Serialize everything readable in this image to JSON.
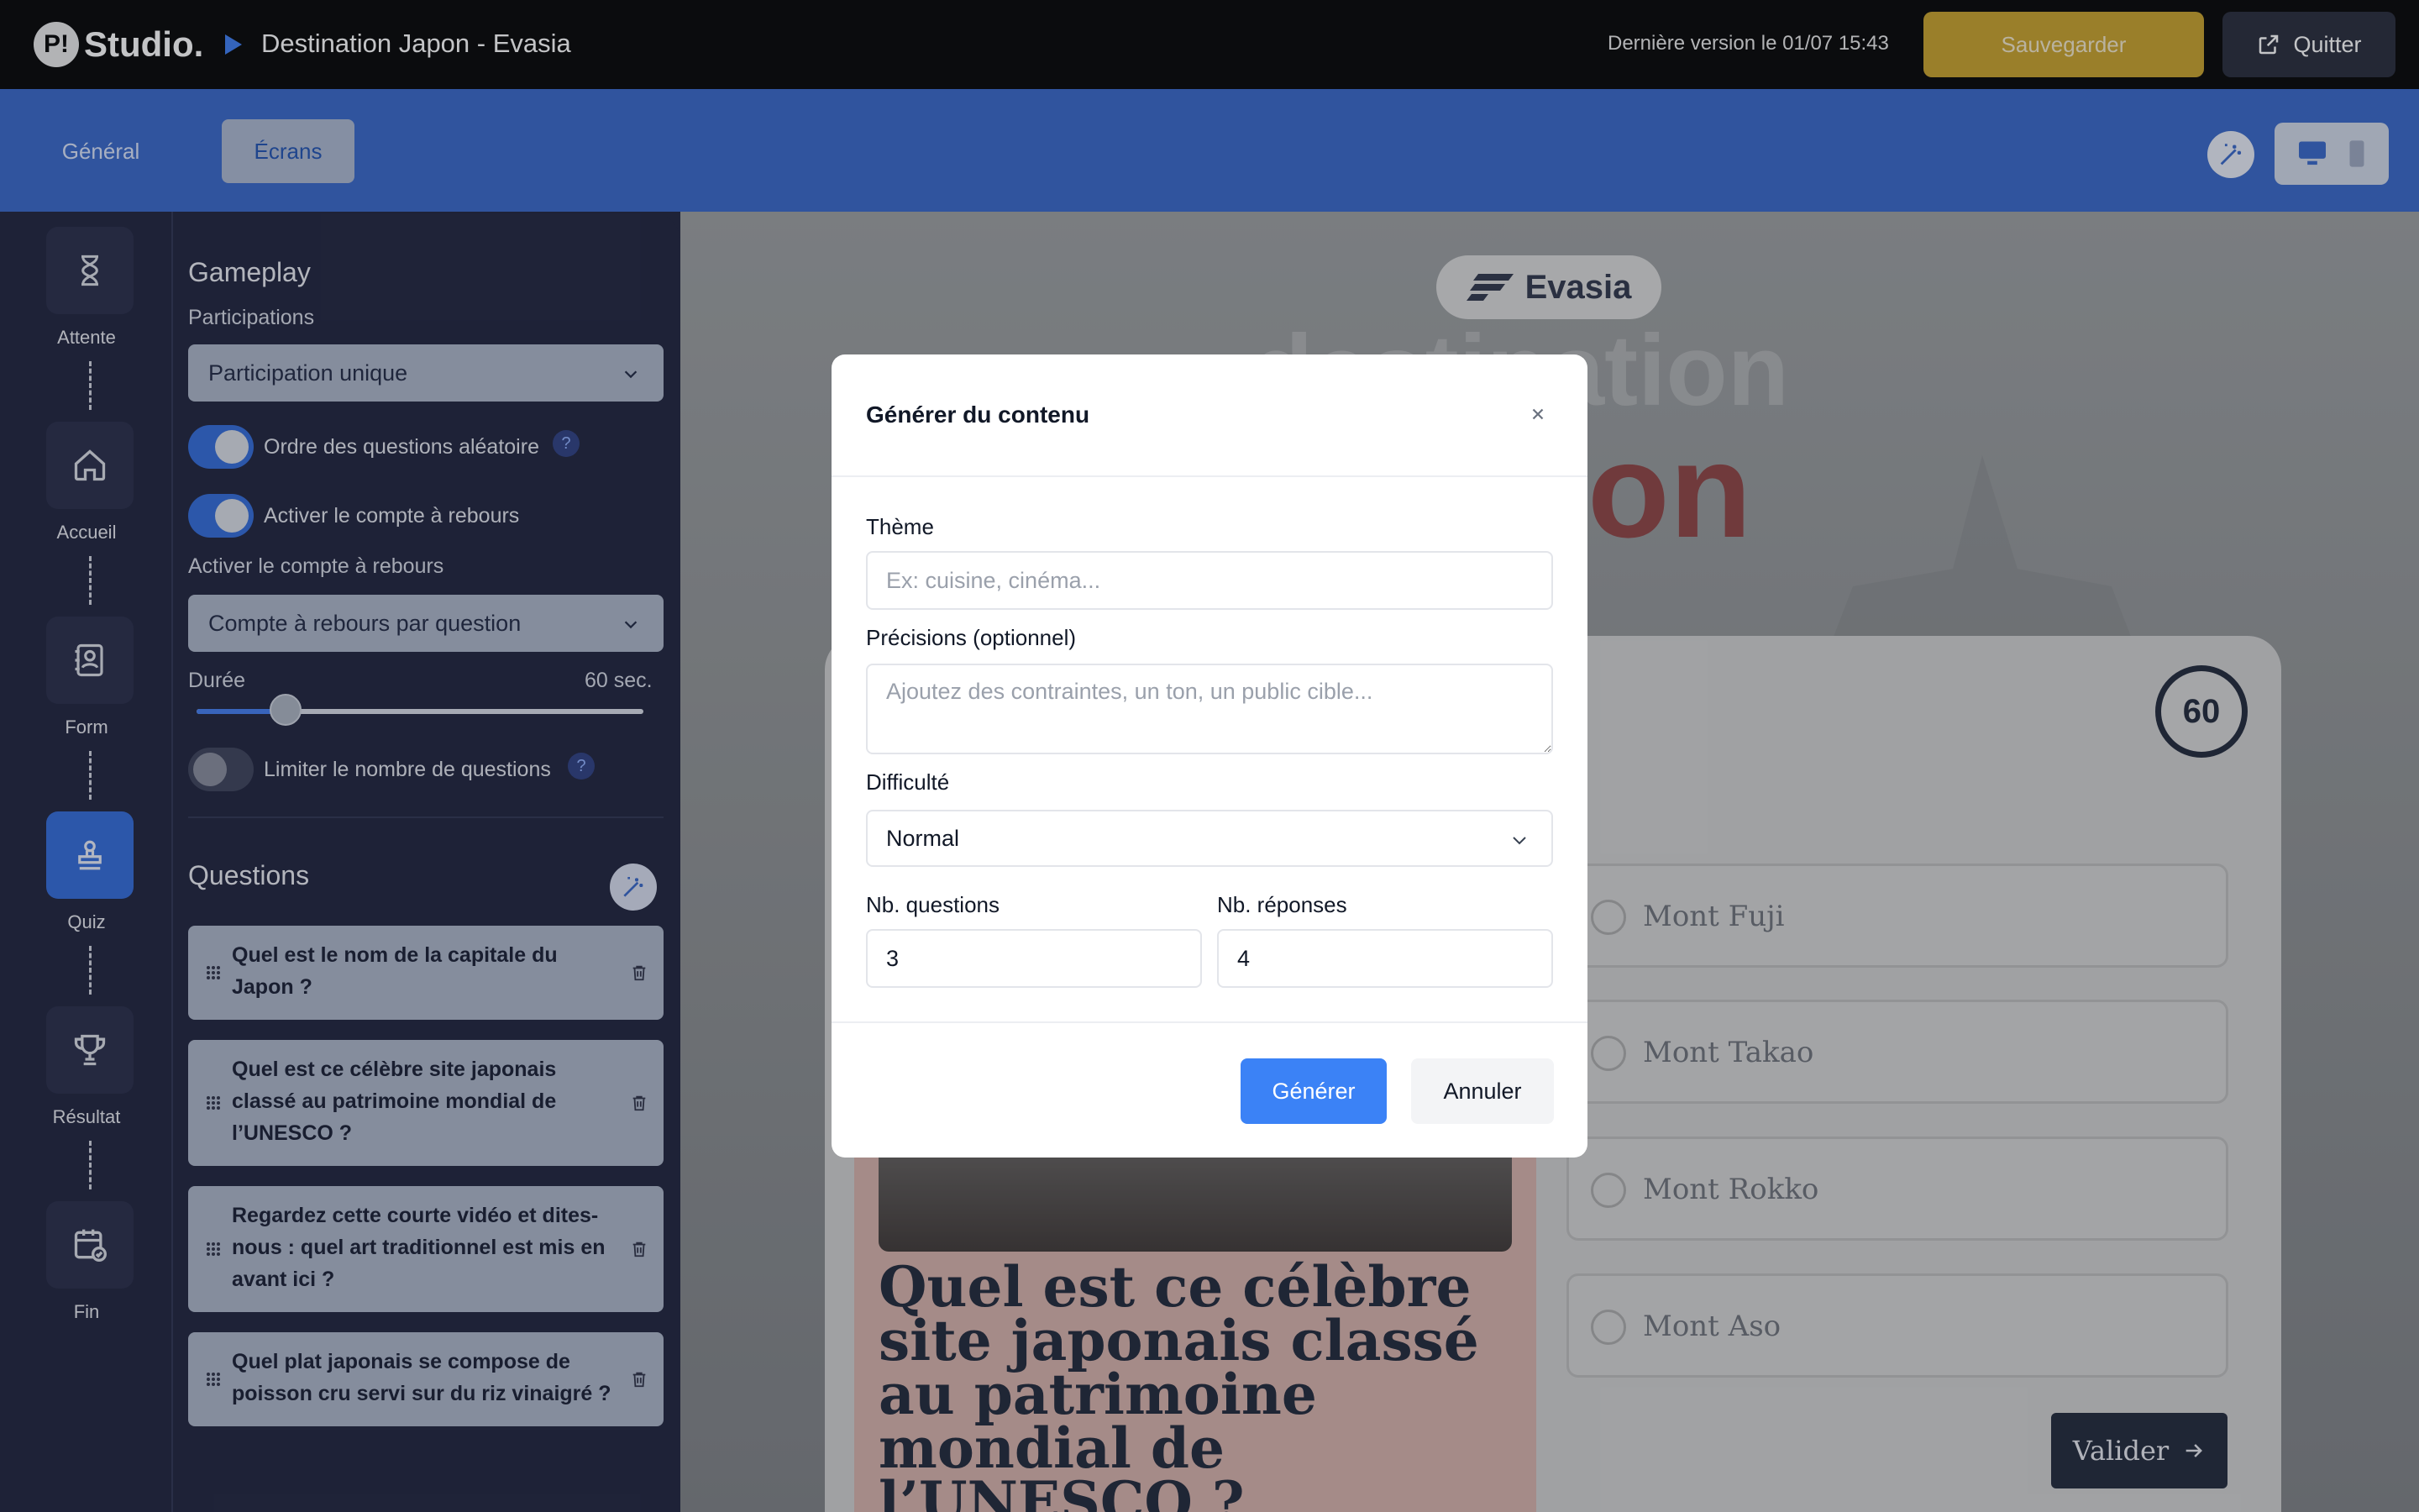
{
  "app": {
    "logo_badge": "P!",
    "logo_text": "Studio.",
    "project_title": "Destination Japon - Evasia",
    "last_version": "Dernière version le 01/07 15:43",
    "save_label": "Sauvegarder",
    "quit_label": "Quitter"
  },
  "tabs": [
    {
      "label": "Général",
      "active": false
    },
    {
      "label": "Écrans",
      "active": true
    }
  ],
  "rail": [
    {
      "label": "Attente",
      "icon": "hourglass-icon",
      "active": false
    },
    {
      "label": "Accueil",
      "icon": "home-icon",
      "active": false
    },
    {
      "label": "Form",
      "icon": "contact-form-icon",
      "active": false
    },
    {
      "label": "Quiz",
      "icon": "quiz-stamp-icon",
      "active": true
    },
    {
      "label": "Résultat",
      "icon": "trophy-icon",
      "active": false
    },
    {
      "label": "Fin",
      "icon": "calendar-check-icon",
      "active": false
    }
  ],
  "settings": {
    "gameplay_title": "Gameplay",
    "participations_label": "Participations",
    "participations_value": "Participation unique",
    "random_order_label": "Ordre des questions aléatoire",
    "random_order_on": true,
    "countdown_toggle_label": "Activer le compte à rebours",
    "countdown_on": true,
    "countdown_select_label": "Activer le compte à rebours",
    "countdown_select_value": "Compte à rebours par question",
    "duration_label": "Durée",
    "duration_value": "60 sec.",
    "duration_slider_fraction": 0.2,
    "limit_label": "Limiter le nombre de questions",
    "limit_on": false,
    "help_glyph": "?"
  },
  "questions": {
    "title": "Questions",
    "items": [
      "Quel est le nom de la capitale du Japon ?",
      "Quel est ce célèbre site japonais classé au patrimoine mondial de l’UNESCO ?",
      "Regardez cette courte vidéo et dites-nous : quel art traditionnel est mis en avant ici ?",
      "Quel plat japonais se compose de poisson cru servi sur du riz vinaigré ?"
    ]
  },
  "preview": {
    "brand": "Evasia",
    "timer": "60",
    "question": "Quel est ce célèbre site japonais classé au patrimoine mondial de l’UNESCO ?",
    "answers": [
      "Mont Fuji",
      "Mont Takao",
      "Mont Rokko",
      "Mont Aso"
    ],
    "validate_label": "Valider"
  },
  "modal": {
    "title": "Générer du contenu",
    "theme_label": "Thème",
    "theme_placeholder": "Ex: cuisine, cinéma...",
    "precisions_label": "Précisions (optionnel)",
    "precisions_placeholder": "Ajoutez des contraintes, un ton, un public cible...",
    "difficulty_label": "Difficulté",
    "difficulty_value": "Normal",
    "nb_questions_label": "Nb. questions",
    "nb_questions_value": "3",
    "nb_answers_label": "Nb. réponses",
    "nb_answers_value": "4",
    "generate_label": "Générer",
    "cancel_label": "Annuler"
  },
  "colors": {
    "accent_blue": "#3464c8",
    "primary_button": "#3b82f6",
    "save_gold": "#c7a028",
    "panel_dark": "#1b1f3a"
  }
}
